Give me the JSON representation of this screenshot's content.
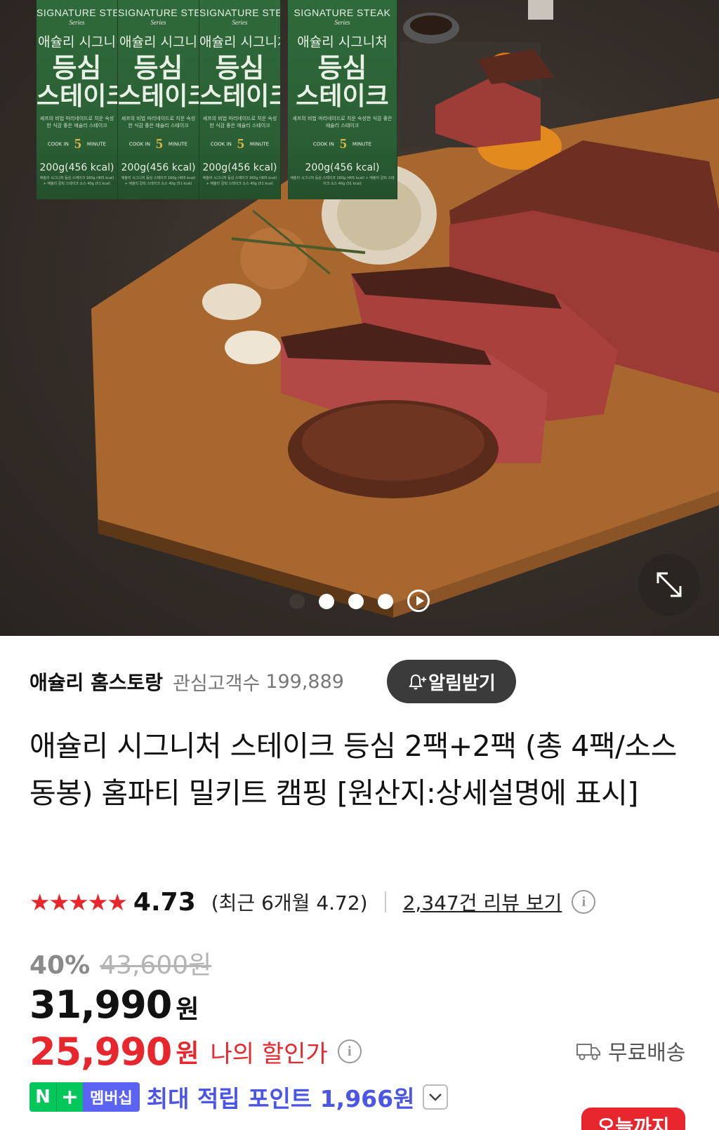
{
  "hero": {
    "packages": [
      {
        "brand_en": "SIGNATURE STE",
        "series": "Series",
        "brand_kr": "애슐리 시그니",
        "name1": "등심",
        "name2": "스테이크",
        "desc": "셰프의 비법 마리네이드로 치운 숙성한 식감 좋은 애슐리 스테이크",
        "cook_a": "COOK IN",
        "cook_num": "5",
        "cook_b": "MINUTE",
        "kcal": "200g(456 kcal)",
        "fine": "애슐리 시그니처 등심 스테이크 160g (405 kcal) + 애슐리 갈릭 스테이크 소스 40g (51 kcal)"
      },
      {
        "brand_en": "SIGNATURE STEA",
        "series": "Series",
        "brand_kr": "애슐리 시그니",
        "name1": "등심",
        "name2": "스테이크",
        "desc": "셰프의 비법 마리네이드로 치운 숙성한 식감 좋은 애슐리 스테이크",
        "cook_a": "COOK IN",
        "cook_num": "5",
        "cook_b": "MINUTE",
        "kcal": "200g(456 kcal)",
        "fine": "애슐리 시그니처 등심 스테이크 160g (405 kcal) + 애슐리 갈릭 스테이크 소스 40g (51 kcal)"
      },
      {
        "brand_en": "SIGNATURE STEAK",
        "series": "Series",
        "brand_kr": "애슐리 시그니처",
        "name1": "등심",
        "name2": "스테이크",
        "desc": "셰프의 비법 마리네이드로 치운 숙성한 식감 좋은 애슐리 스테이크",
        "cook_a": "COOK IN",
        "cook_num": "5",
        "cook_b": "MINUTE",
        "kcal": "200g(456 kcal)",
        "fine": "애슐리 시그니처 등심 스테이크 160g (405 kcal) + 애슐리 갈릭 스테이크 소스 40g (51 kcal)"
      },
      {
        "brand_en": "SIGNATURE STEAK",
        "series": "Series",
        "brand_kr": "애슐리 시그니처",
        "name1": "등심",
        "name2": "스테이크",
        "desc": "셰프의 비법 마리네이드로 치운 숙성한 식감 좋은 애슐리 스테이크",
        "cook_a": "COOK IN",
        "cook_num": "5",
        "cook_b": "MINUTE",
        "kcal": "200g(456 kcal)",
        "fine": "애슐리 시그니처 등심 스테이크 160g (405 kcal) + 애슐리 갈릭 스테이크 소스 40g (51 kcal)"
      }
    ],
    "carousel": {
      "total_dots": 4,
      "active_index": 0
    },
    "icons": {
      "play": "play-icon",
      "expand": "expand-icon"
    }
  },
  "store": {
    "name": "애슐리 홈스토랑",
    "fans_label": "관심고객수",
    "fans_count": "199,889",
    "alarm_label": "알림받기"
  },
  "product": {
    "title": "애슐리 시그니처 스테이크 등심 2팩+2팩 (총 4팩/소스동봉) 홈파티 밀키트 캠핑 [원산지:상세설명에 표시]"
  },
  "rating": {
    "stars": "★★★★★",
    "score": "4.73",
    "recent": "(최근 6개월 4.72)",
    "reviews": "2,347건 리뷰 보기"
  },
  "price": {
    "discount": "40%",
    "original": "43,600원",
    "sale": "31,990",
    "sale_unit": "원",
    "my_price": "25,990",
    "my_unit": "원",
    "my_label": "나의 할인가",
    "shipping": "무료배송"
  },
  "points": {
    "n_label": "N",
    "plus_label": "+",
    "membership": "멤버십",
    "text": "최대 적립 포인트 1,966원"
  },
  "badge": {
    "today": "오늘까지"
  },
  "colors": {
    "accent_red": "#e8262d",
    "naver_green": "#03c75a",
    "membership_blue": "#5b63f2",
    "points_blue": "#4b55e8",
    "package_green": "#2f6a3a"
  }
}
